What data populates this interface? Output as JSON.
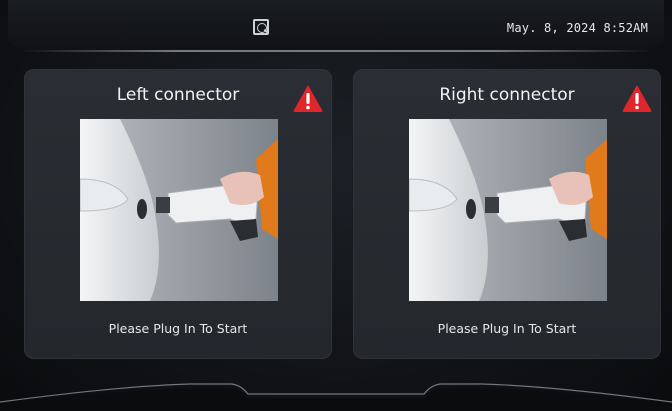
{
  "header": {
    "logo_icon": "scan-logo-icon",
    "datetime": "May. 8, 2024  8:52AM"
  },
  "connectors": [
    {
      "title": "Left connector",
      "status": "Please Plug In To Start",
      "alert_icon": "warning-triangle-icon"
    },
    {
      "title": "Right connector",
      "status": "Please Plug In To Start",
      "alert_icon": "warning-triangle-icon"
    }
  ],
  "colors": {
    "warning_red": "#e0262b",
    "panel_bg": "#2a2e34",
    "background": "#121418"
  }
}
